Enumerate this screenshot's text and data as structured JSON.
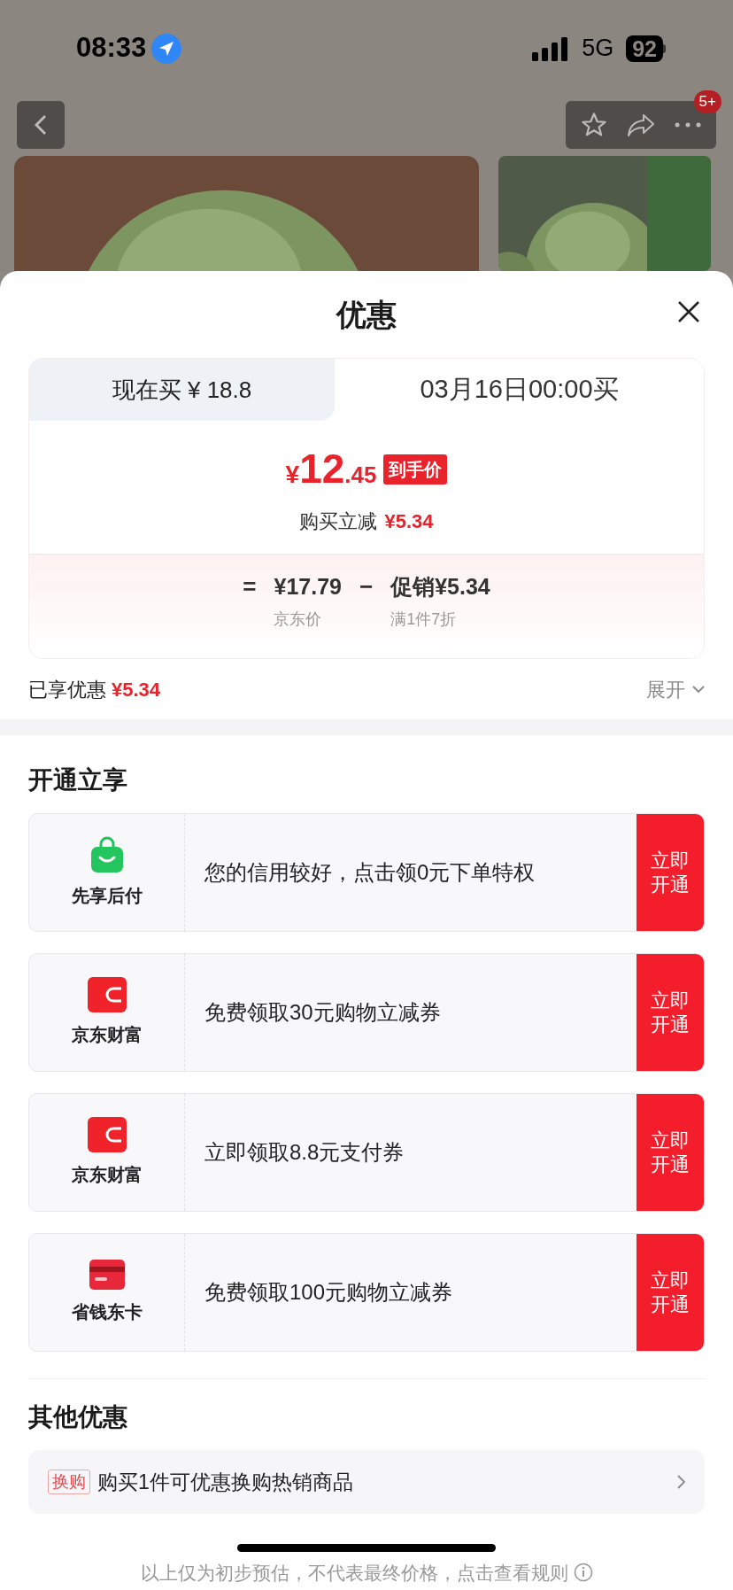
{
  "status_bar": {
    "time": "08:33",
    "network": "5G",
    "battery": "92"
  },
  "product_nav": {
    "badge": "5+"
  },
  "sheet": {
    "title": "优惠",
    "tabs": [
      {
        "label": "现在买 ¥ 18.8",
        "selected": false
      },
      {
        "label": "03月16日00:00买",
        "selected": true
      }
    ],
    "final_price": {
      "currency": "¥",
      "integer": "12",
      "decimal": ".45",
      "tag": "到手价"
    },
    "reduction": {
      "label": "购买立减",
      "amount": "¥5.34"
    },
    "formula": [
      {
        "kind": "operator",
        "text": "="
      },
      {
        "kind": "term",
        "text": "¥17.79",
        "note": "京东价"
      },
      {
        "kind": "operator",
        "text": "−"
      },
      {
        "kind": "term",
        "text": "促销¥5.34",
        "note": "满1件7折"
      }
    ],
    "enjoyed": {
      "label": "已享优惠",
      "amount": "¥5.34",
      "expand": "展开"
    },
    "open_section": {
      "title": "开通立享",
      "rows": [
        {
          "kind": "bag",
          "name": "先享后付",
          "text": "您的信用较好，点击领0元下单特权",
          "button": "立即开通"
        },
        {
          "kind": "wallet",
          "name": "京东财富",
          "text": "免费领取30元购物立减券",
          "button": "立即开通"
        },
        {
          "kind": "wallet",
          "name": "京东财富",
          "text": "立即领取8.8元支付券",
          "button": "立即开通"
        },
        {
          "kind": "card",
          "name": "省钱东卡",
          "text": "免费领取100元购物立减券",
          "button": "立即开通"
        }
      ]
    },
    "other_section": {
      "title": "其他优惠",
      "rows": [
        {
          "tag": "换购",
          "text": "购买1件可优惠换购热销商品"
        }
      ]
    },
    "footnote": "以上仅为初步预估，不代表最终价格，点击查看规则"
  }
}
